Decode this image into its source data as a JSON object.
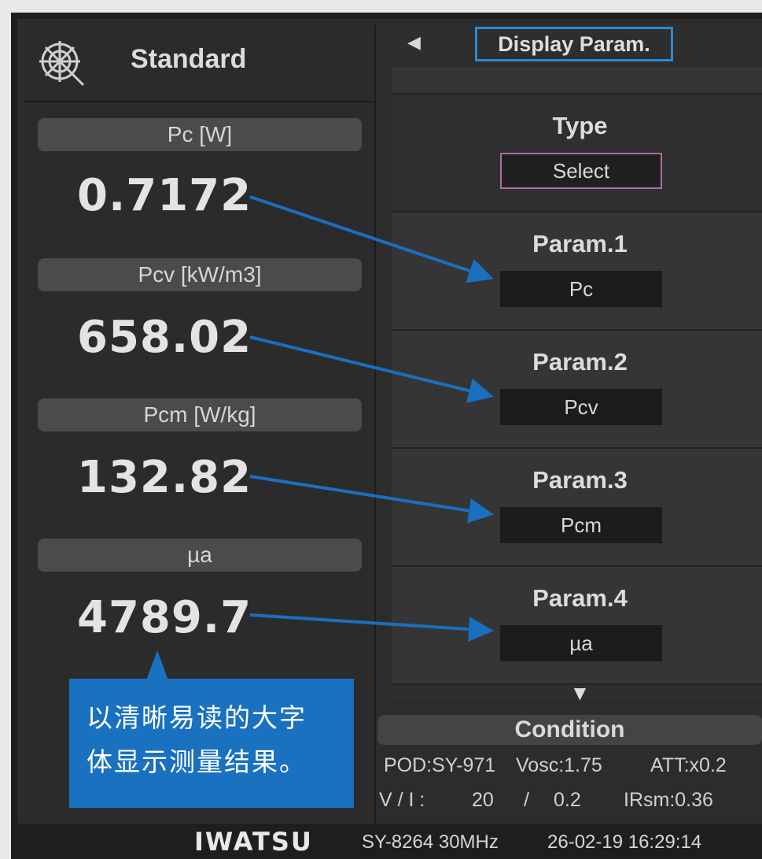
{
  "left": {
    "mode_title": "Standard",
    "measurements": [
      {
        "label": "Pc [W]",
        "value": "0.7172"
      },
      {
        "label": "Pcv [kW/m3]",
        "value": "658.02"
      },
      {
        "label": "Pcm [W/kg]",
        "value": "132.82"
      },
      {
        "label": "µa",
        "value": "4789.7"
      }
    ]
  },
  "callout": {
    "line1": "以清晰易读的大字",
    "line2": "体显示测量结果。"
  },
  "right": {
    "title": "Display Param.",
    "type": {
      "label": "Type",
      "value": "Select"
    },
    "params": [
      {
        "label": "Param.1",
        "value": "Pc"
      },
      {
        "label": "Param.2",
        "value": "Pcv"
      },
      {
        "label": "Param.3",
        "value": "Pcm"
      },
      {
        "label": "Param.4",
        "value": "µa"
      }
    ]
  },
  "condition": {
    "label": "Condition",
    "pod": "POD:SY-971",
    "vosc": "Vosc:1.75",
    "att": "ATT:x0.2",
    "vi_label": "V / I :",
    "v_value": "20",
    "slash": "/",
    "i_value": "0.2",
    "irsm": "IRsm:0.36"
  },
  "footer": {
    "brand": "IWATSU",
    "model": "SY-8264 30MHz",
    "datetime": "26-02-19 16:29:14"
  },
  "colors": {
    "accent": "#1a71bf",
    "title_border": "#2a8ad6",
    "select_border": "#b06ca4"
  },
  "icons": {
    "mode": "target-mode-icon",
    "back": "left-triangle-icon",
    "scroll": "down-triangle-icon"
  }
}
